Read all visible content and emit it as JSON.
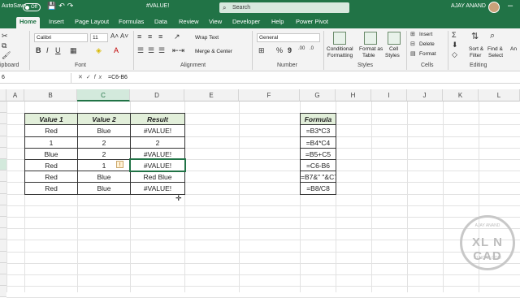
{
  "titlebar": {
    "autosave_label": "AutoSave",
    "autosave_state": "Off",
    "file_name": "#VALUE!",
    "search_placeholder": "Search",
    "user_name": "AJAY ANAND"
  },
  "tabs": [
    "Home",
    "Insert",
    "Page Layout",
    "Formulas",
    "Data",
    "Review",
    "View",
    "Developer",
    "Help",
    "Power Pivot"
  ],
  "active_tab": "Home",
  "ribbon": {
    "font_name": "Calibri",
    "font_size": "11",
    "wrap_text": "Wrap Text",
    "merge_center": "Merge & Center",
    "number_format": "General",
    "groups": {
      "clipboard": "ipboard",
      "font": "Font",
      "alignment": "Alignment",
      "number": "Number",
      "styles": "Styles",
      "cells": "Cells",
      "editing": "Editing"
    },
    "styles_buttons": {
      "conditional": "Conditional",
      "conditional2": "Formatting",
      "format_as": "Format as",
      "format_as2": "Table",
      "cell": "Cell",
      "cell2": "Styles"
    },
    "cells_buttons": {
      "insert": "Insert",
      "delete": "Delete",
      "format": "Format"
    },
    "editing_buttons": {
      "sort": "Sort &",
      "sort2": "Filter",
      "find": "Find &",
      "find2": "Select",
      "an": "An"
    }
  },
  "formula_bar": {
    "name_box": "6",
    "fx": "fx",
    "content": "=C6-B6"
  },
  "columns": [
    "A",
    "B",
    "C",
    "D",
    "E",
    "F",
    "G",
    "H",
    "I",
    "J",
    "K",
    "L"
  ],
  "table": {
    "headers": [
      "Value 1",
      "Value 2",
      "Result"
    ],
    "rows": [
      [
        "Red",
        "Blue",
        "#VALUE!"
      ],
      [
        "1",
        "2",
        "2"
      ],
      [
        "Blue",
        "2",
        "#VALUE!"
      ],
      [
        "Red",
        "1",
        "#VALUE!"
      ],
      [
        "Red",
        "Blue",
        "Red Blue"
      ],
      [
        "Red",
        "Blue",
        "#VALUE!"
      ]
    ]
  },
  "formula_table": {
    "header": "Formula",
    "rows": [
      "=B3*C3",
      "=B4*C4",
      "=B5+C5",
      "=C6-B6",
      "=B7&\" \"&C7",
      "=B8/C8"
    ]
  },
  "watermark": {
    "main": "XL N CAD",
    "top": "AJAY ANAND",
    "bottom": "XLNCAD.COM"
  }
}
